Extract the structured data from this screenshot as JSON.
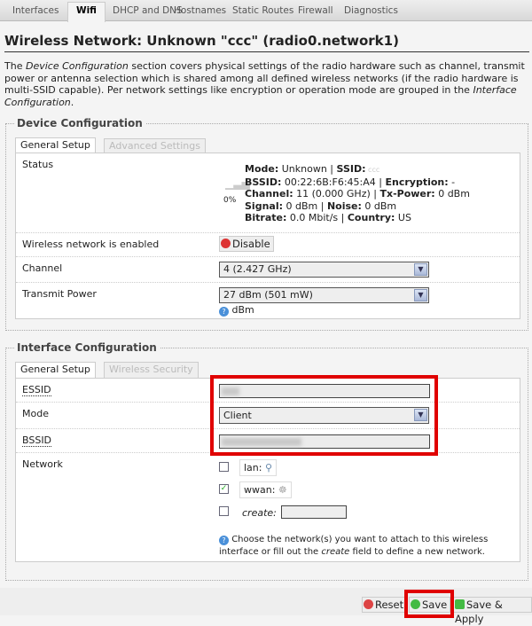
{
  "tabs": [
    "Interfaces",
    "Wifi",
    "DHCP and DNS",
    "Hostnames",
    "Static Routes",
    "Firewall",
    "Diagnostics"
  ],
  "active_tab": "Wifi",
  "title": "Wireless Network: Unknown \"ccc\" (radio0.network1)",
  "description": {
    "p1": "The ",
    "em1": "Device Configuration",
    "p2": " section covers physical settings of the radio hardware such as channel, transmit power or antenna selection which is shared among all defined wireless networks (if the radio hardware is multi-SSID capable). Per network settings like encryption or operation mode are grouped in the ",
    "em2": "Interface Configuration",
    "p3": "."
  },
  "device": {
    "legend": "Device Configuration",
    "tabs": [
      "General Setup",
      "Advanced Settings"
    ],
    "status_label": "Status",
    "signal_pct": "0%",
    "status": {
      "mode_k": "Mode:",
      "mode_v": " Unknown | ",
      "ssid_k": "SSID:",
      "ssid_v": " ccc",
      "bssid_k": "BSSID:",
      "bssid_v": " 00:22:6B:F6:45:A4 | ",
      "enc_k": "Encryption:",
      "enc_v": " -",
      "ch_k": "Channel:",
      "ch_v": " 11 (0.000 GHz) | ",
      "tx_k": "Tx-Power:",
      "tx_v": " 0 dBm",
      "sig_k": "Signal:",
      "sig_v": " 0 dBm | ",
      "noise_k": "Noise:",
      "noise_v": " 0 dBm",
      "br_k": "Bitrate:",
      "br_v": " 0.0 Mbit/s | ",
      "c_k": "Country:",
      "c_v": " US"
    },
    "enabled_label": "Wireless network is enabled",
    "disable_button": "Disable",
    "channel_label": "Channel",
    "channel_value": "4 (2.427 GHz)",
    "txpower_label": "Transmit Power",
    "txpower_value": "27 dBm (501 mW)",
    "txpower_hint": "dBm"
  },
  "iface": {
    "legend": "Interface Configuration",
    "tabs": [
      "General Setup",
      "Wireless Security"
    ],
    "essid_label": "ESSID",
    "mode_label": "Mode",
    "mode_value": "Client",
    "bssid_label": "BSSID",
    "network_label": "Network",
    "networks": [
      {
        "name": "lan:",
        "checked": false
      },
      {
        "name": "wwan:",
        "checked": true
      }
    ],
    "create_label": "create:",
    "hint_a": "Choose the network(s) you want to attach to this wireless interface or fill out the ",
    "hint_em": "create",
    "hint_b": " field to define a new network."
  },
  "buttons": {
    "reset": "Reset",
    "save": "Save",
    "save_apply": "Save & Apply"
  },
  "colors": {
    "highlight": "#e00000"
  }
}
